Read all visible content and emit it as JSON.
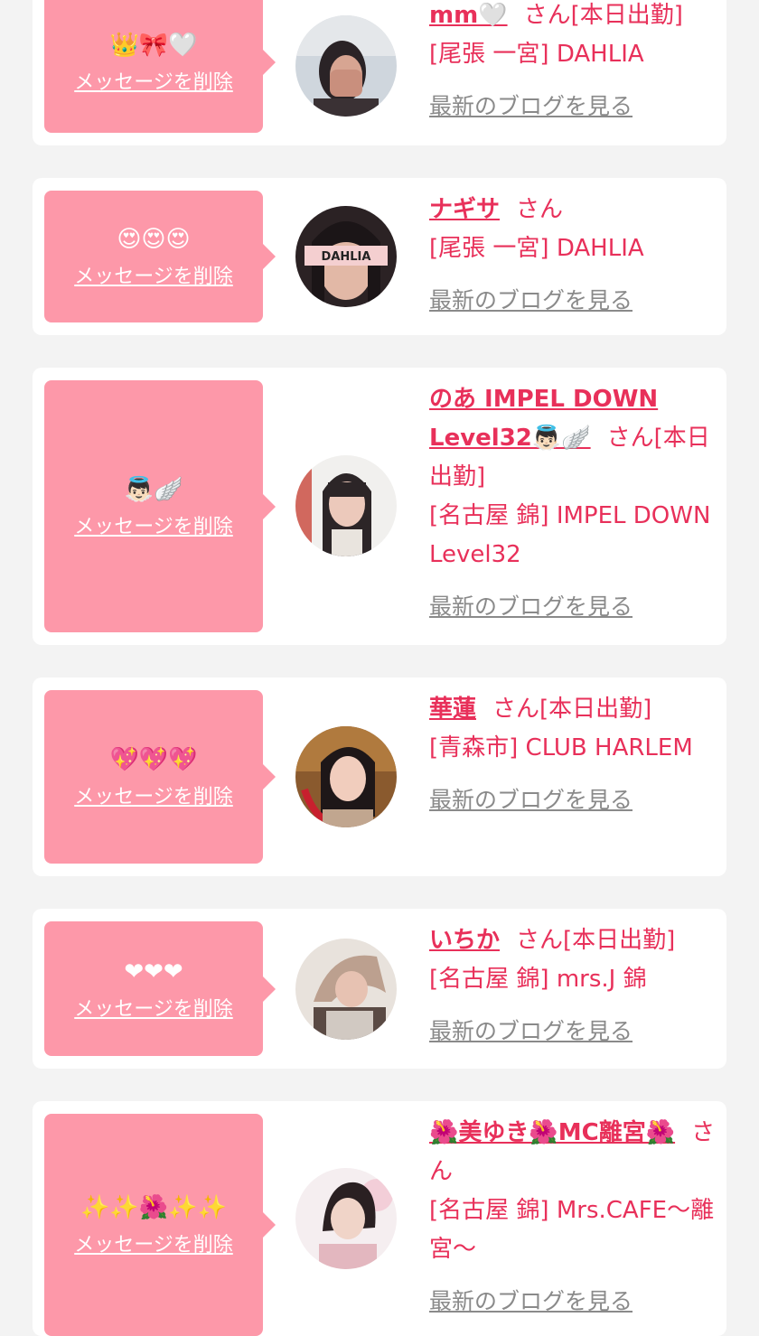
{
  "common": {
    "delete_label": "メッセージを削除",
    "blog_label": "最新のブログを見る",
    "san": "さん"
  },
  "cards": [
    {
      "message": "👑🎀🤍",
      "name": "mm🤍",
      "status": "[本日出勤]",
      "shop": "[尾張 一宮] DAHLIA"
    },
    {
      "message": "😍😍😍",
      "name": "ナギサ",
      "status": "",
      "shop": "[尾張 一宮] DAHLIA",
      "avatar_text": "DAHLIA"
    },
    {
      "message": "👼🏻🪽",
      "name": "のあ IMPEL DOWN Level32👼🏻🪽",
      "status": "[本日出勤]",
      "shop": "[名古屋 錦] IMPEL DOWN Level32"
    },
    {
      "message": "💖💖💖",
      "name": "華蓮",
      "status": "[本日出勤]",
      "shop": "[青森市] CLUB HARLEM"
    },
    {
      "message": "❤❤❤",
      "name": "いちか",
      "status": "[本日出勤]",
      "shop": "[名古屋 錦] mrs.J 錦"
    },
    {
      "message": "✨✨🌺✨✨",
      "name": "🌺美ゆき🌺MC離宮🌺",
      "status": "",
      "shop": "[名古屋 錦] Mrs.CAFE〜離宮〜"
    }
  ],
  "colors": {
    "accent": "#e8305a",
    "bubble": "#fd98a9",
    "card_bg": "#ffffff",
    "page_bg": "#f3f3f3",
    "blog_link": "#8a8a8a"
  }
}
